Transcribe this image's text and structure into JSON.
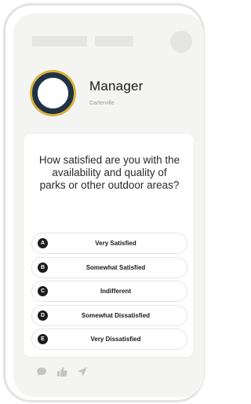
{
  "profile": {
    "name": "Manager",
    "location": "Carterville"
  },
  "survey": {
    "question": "How satisfied are you with the availability and quality of parks or other outdoor areas?",
    "options": [
      {
        "letter": "A",
        "label": "Very Satisfied"
      },
      {
        "letter": "B",
        "label": "Somewhat Satisfied"
      },
      {
        "letter": "C",
        "label": "Indifferent"
      },
      {
        "letter": "D",
        "label": "Somewhat Dissatisfied"
      },
      {
        "letter": "E",
        "label": "Very Dissatisfied"
      }
    ]
  },
  "actions": {
    "icons": [
      "comment-icon",
      "thumbs-up-icon",
      "send-icon"
    ]
  },
  "colors": {
    "avatar_ring": "#1f3246",
    "avatar_accent": "#d9b13b",
    "icon_gray": "#c4c4c4"
  }
}
